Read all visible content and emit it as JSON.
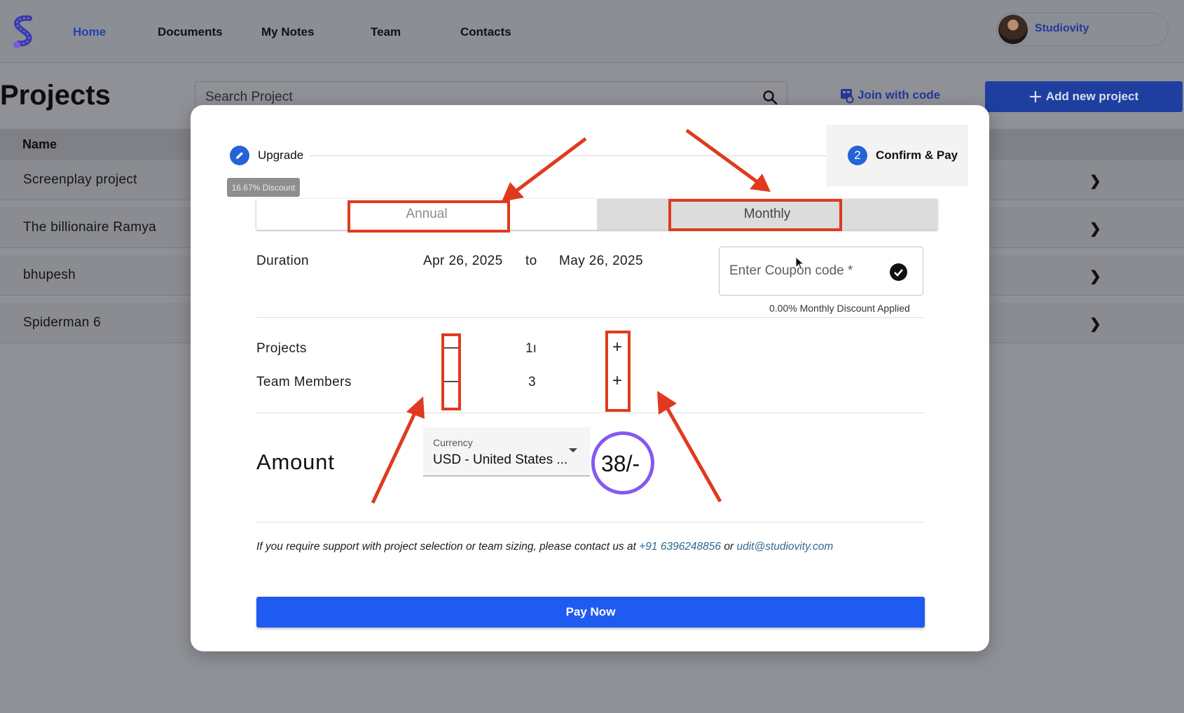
{
  "nav": {
    "links": [
      "Home",
      "Documents",
      "My Notes",
      "Team",
      "Contacts"
    ],
    "active": "Home",
    "profile_name": "Studiovity"
  },
  "page": {
    "title": "Projects",
    "search_placeholder": "Search Project",
    "join_code_label": "Join with code",
    "add_project_label": "Add new project"
  },
  "table": {
    "header": "Name",
    "rows": [
      "Screenplay project",
      "The billionaire Ramya",
      "bhupesh",
      "Spiderman 6"
    ]
  },
  "modal": {
    "steps": [
      {
        "number": "1",
        "label": "Upgrade",
        "icon": "pencil-icon",
        "state": "completed"
      },
      {
        "number": "2",
        "label": "Confirm & Pay",
        "state": "active"
      }
    ],
    "discount_chip": "16.67% Discount",
    "billing": {
      "annual_label": "Annual",
      "monthly_label": "Monthly",
      "selected": "Monthly"
    },
    "duration": {
      "label": "Duration",
      "start": "Apr 26, 2025",
      "separator": "to",
      "end": "May 26, 2025"
    },
    "coupon": {
      "placeholder": "Enter Coupon code *",
      "discount_note": "0.00% Monthly Discount Applied"
    },
    "projects": {
      "label": "Projects",
      "value": "1ı",
      "minus": "—",
      "plus": "+"
    },
    "team_members": {
      "label": "Team Members",
      "value": "3",
      "minus": "—",
      "plus": "+"
    },
    "amount": {
      "label": "Amount",
      "currency_caption": "Currency",
      "currency_value": "USD - United States ...",
      "value": "38/-"
    },
    "support": {
      "text": "If you require support with project selection or team sizing, please contact us at",
      "phone": "+91 6396248856",
      "or": "or",
      "email": "udit@studiovity.com"
    },
    "pay_button": "Pay Now"
  },
  "colors": {
    "primary": "#1f5bf0",
    "step_active": "#2463d8",
    "annotation_red": "#e03a1e",
    "annotation_circle": "#8757f2",
    "link": "#2e6a8f"
  }
}
